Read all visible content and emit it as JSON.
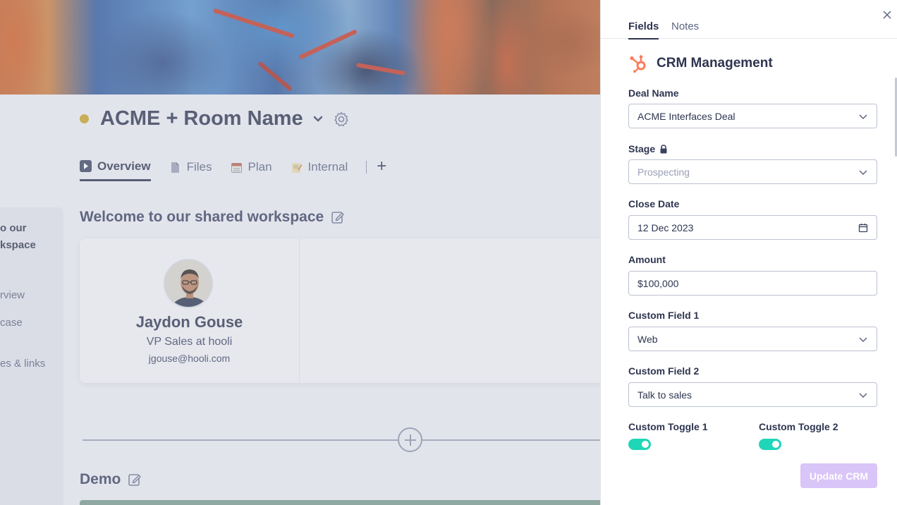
{
  "room": {
    "title": "ACME + Room Name",
    "tabs": [
      {
        "label": "Overview",
        "icon": "play-icon"
      },
      {
        "label": "Files",
        "icon": "file-icon"
      },
      {
        "label": "Plan",
        "icon": "calendar-icon"
      },
      {
        "label": "Internal",
        "icon": "memo-icon"
      }
    ],
    "add_tab_label": "+"
  },
  "left_nav": {
    "title_line1": "o our",
    "title_line2": "kspace",
    "items": [
      "rview",
      "case",
      "es & links"
    ]
  },
  "welcome": {
    "title": "Welcome to our shared workspace"
  },
  "profile": {
    "name": "Jaydon Gouse",
    "role": "VP Sales at hooli",
    "email": "jgouse@hooli.com"
  },
  "demo": {
    "title": "Demo"
  },
  "panel": {
    "tabs": [
      "Fields",
      "Notes"
    ],
    "crm_title": "CRM Management",
    "fields": {
      "deal_name": {
        "label": "Deal Name",
        "value": "ACME Interfaces Deal"
      },
      "stage": {
        "label": "Stage",
        "value": "Prospecting"
      },
      "close_date": {
        "label": "Close Date",
        "value": "12 Dec 2023"
      },
      "amount": {
        "label": "Amount",
        "value": "$100,000"
      },
      "custom_field_1": {
        "label": "Custom Field 1",
        "value": "Web"
      },
      "custom_field_2": {
        "label": "Custom Field 2",
        "value": "Talk to sales"
      }
    },
    "toggles": [
      {
        "label": "Custom Toggle 1",
        "on": true
      },
      {
        "label": "Custom Toggle 2",
        "on": true
      }
    ],
    "update_button": "Update CRM"
  },
  "colors": {
    "toggle_on": "#1fd6b8",
    "update_button_bg": "#d9c5f7",
    "status_dot": "#c9a326",
    "hubspot_orange": "#ff7a59"
  }
}
